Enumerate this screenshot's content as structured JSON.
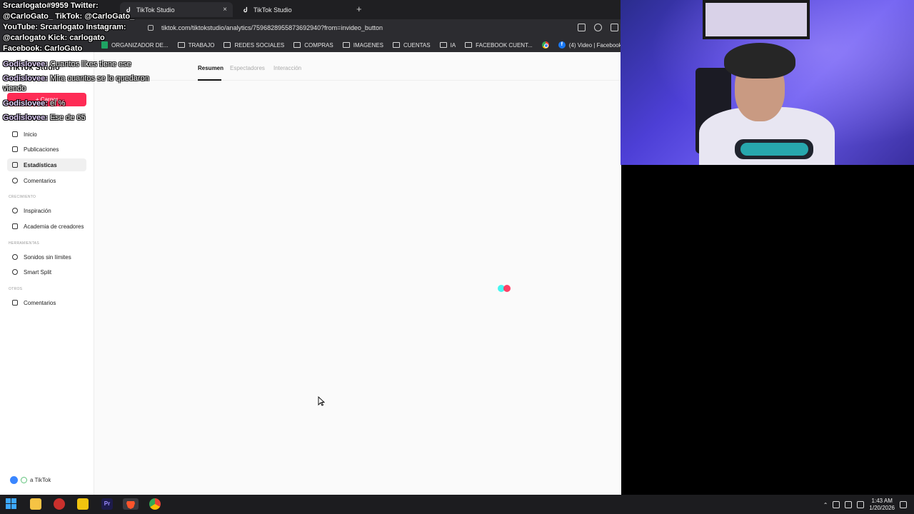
{
  "browser": {
    "tabs": [
      {
        "label": "TikTok Studio",
        "active": true
      },
      {
        "label": "TikTok Studio",
        "active": false
      }
    ],
    "new_tab_label": "+",
    "close_label": "×",
    "url": "tiktok.com/tiktokstudio/analytics/7596828955873692940?from=invideo_button",
    "bookmarks": [
      {
        "label": "ORGANIZADOR DE...",
        "icon": "sheets-icon"
      },
      {
        "label": "TRABAJO",
        "icon": "folder-icon"
      },
      {
        "label": "REDES SOCIALES",
        "icon": "folder-icon"
      },
      {
        "label": "COMPRAS",
        "icon": "folder-icon"
      },
      {
        "label": "IMAGENES",
        "icon": "folder-icon"
      },
      {
        "label": "CUENTAS",
        "icon": "folder-icon"
      },
      {
        "label": "IA",
        "icon": "folder-icon"
      },
      {
        "label": "FACEBOOK CUENT...",
        "icon": "folder-icon"
      },
      {
        "label": "(4) Video | Facebook",
        "icon": "facebook-icon"
      }
    ]
  },
  "studio": {
    "logo": "TikTok Studio",
    "upload_label": "+ Cargar",
    "nav": [
      {
        "label": "Inicio",
        "icon": "home-icon",
        "active": false
      },
      {
        "label": "Publicaciones",
        "icon": "posts-icon",
        "active": false
      },
      {
        "label": "Estadísticas",
        "icon": "analytics-icon",
        "active": true
      },
      {
        "label": "Comentarios",
        "icon": "comments-icon",
        "active": false
      }
    ],
    "sections": {
      "crecimiento": "CRECIMIENTO",
      "herramientas": "HERRAMIENTAS",
      "otros": "OTROS"
    },
    "growth_items": [
      {
        "label": "Inspiración",
        "icon": "bulb-icon"
      },
      {
        "label": "Academia de creadores",
        "icon": "academy-icon"
      }
    ],
    "tools_items": [
      {
        "label": "Sonidos sin límites",
        "icon": "music-icon"
      },
      {
        "label": "Smart Split",
        "icon": "scissors-icon"
      }
    ],
    "other_items": [
      {
        "label": "Comentarios",
        "icon": "comments-icon"
      }
    ],
    "footer_link": "a TikTok",
    "page_tabs": [
      {
        "label": "Resumen",
        "active": true
      },
      {
        "label": "Espectadores",
        "active": false
      },
      {
        "label": "Interacción",
        "active": false
      }
    ]
  },
  "overlay": {
    "socials": "Srcarlogato#9959 Twitter: @CarloGato_ TikTok: @CarloGato_ YouTube: Srcarlogato Instagram: @carlogato Kick: carlogato Facebook: CarloGato",
    "chat": [
      {
        "user": "Godislovee:",
        "message": "Cuantos likes tiene ese"
      },
      {
        "user": "Godislovee:",
        "message": "Mira cuantos se lo quedaron viendo"
      },
      {
        "user": "Godislovee:",
        "message": "el %"
      },
      {
        "user": "Godislovee:",
        "message": "Ese de 65"
      }
    ]
  },
  "taskbar": {
    "time": "1:43 AM",
    "date": "1/20/2026"
  },
  "colors": {
    "tiktok_red": "#fe2c55",
    "tiktok_cyan": "#25f4ee",
    "chrome_dark": "#2c2c30",
    "taskbar": "#1c1c1f"
  }
}
